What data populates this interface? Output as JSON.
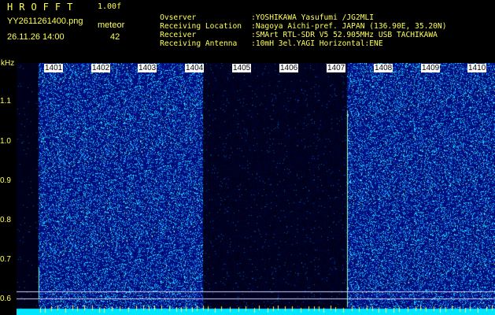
{
  "header": {
    "app_title": "HROFFT",
    "version": "1.00f",
    "filename": "YY2611261400.png",
    "timestamp": "26.11.26 14:00",
    "meteor_label": "meteor",
    "meteor_count": "42"
  },
  "info": {
    "observer": {
      "label": "Ovserver",
      "value": ":YOSHIKAWA Yasufumi /JG2MLI"
    },
    "location": {
      "label": "Receiving Location",
      "value": ":Nagoya Aichi-pref. JAPAN (136.90E, 35.20N)"
    },
    "receiver": {
      "label": "Receiver",
      "value": ":SMArt RTL-SDR V5 52.905MHz USB TACHIKAWA"
    },
    "antenna": {
      "label": "Receiving Antenna",
      "value": ":10mH 3el.YAGI Horizontal:ENE"
    }
  },
  "axis": {
    "unit": "kHz",
    "y_labels": [
      "1.1",
      "1.0",
      "0.9",
      "0.8",
      "0.7",
      "0.6"
    ],
    "time_labels": [
      "1401",
      "1402",
      "1403",
      "1404",
      "1405",
      "1406",
      "1407",
      "1408",
      "1409",
      "1410"
    ]
  },
  "colors": {
    "text": "#ffff55",
    "background": "#000000",
    "spectrum_fill": "#0a1a8c",
    "noise_dot": "#3cc0ff",
    "baseline": "#00ffff"
  }
}
